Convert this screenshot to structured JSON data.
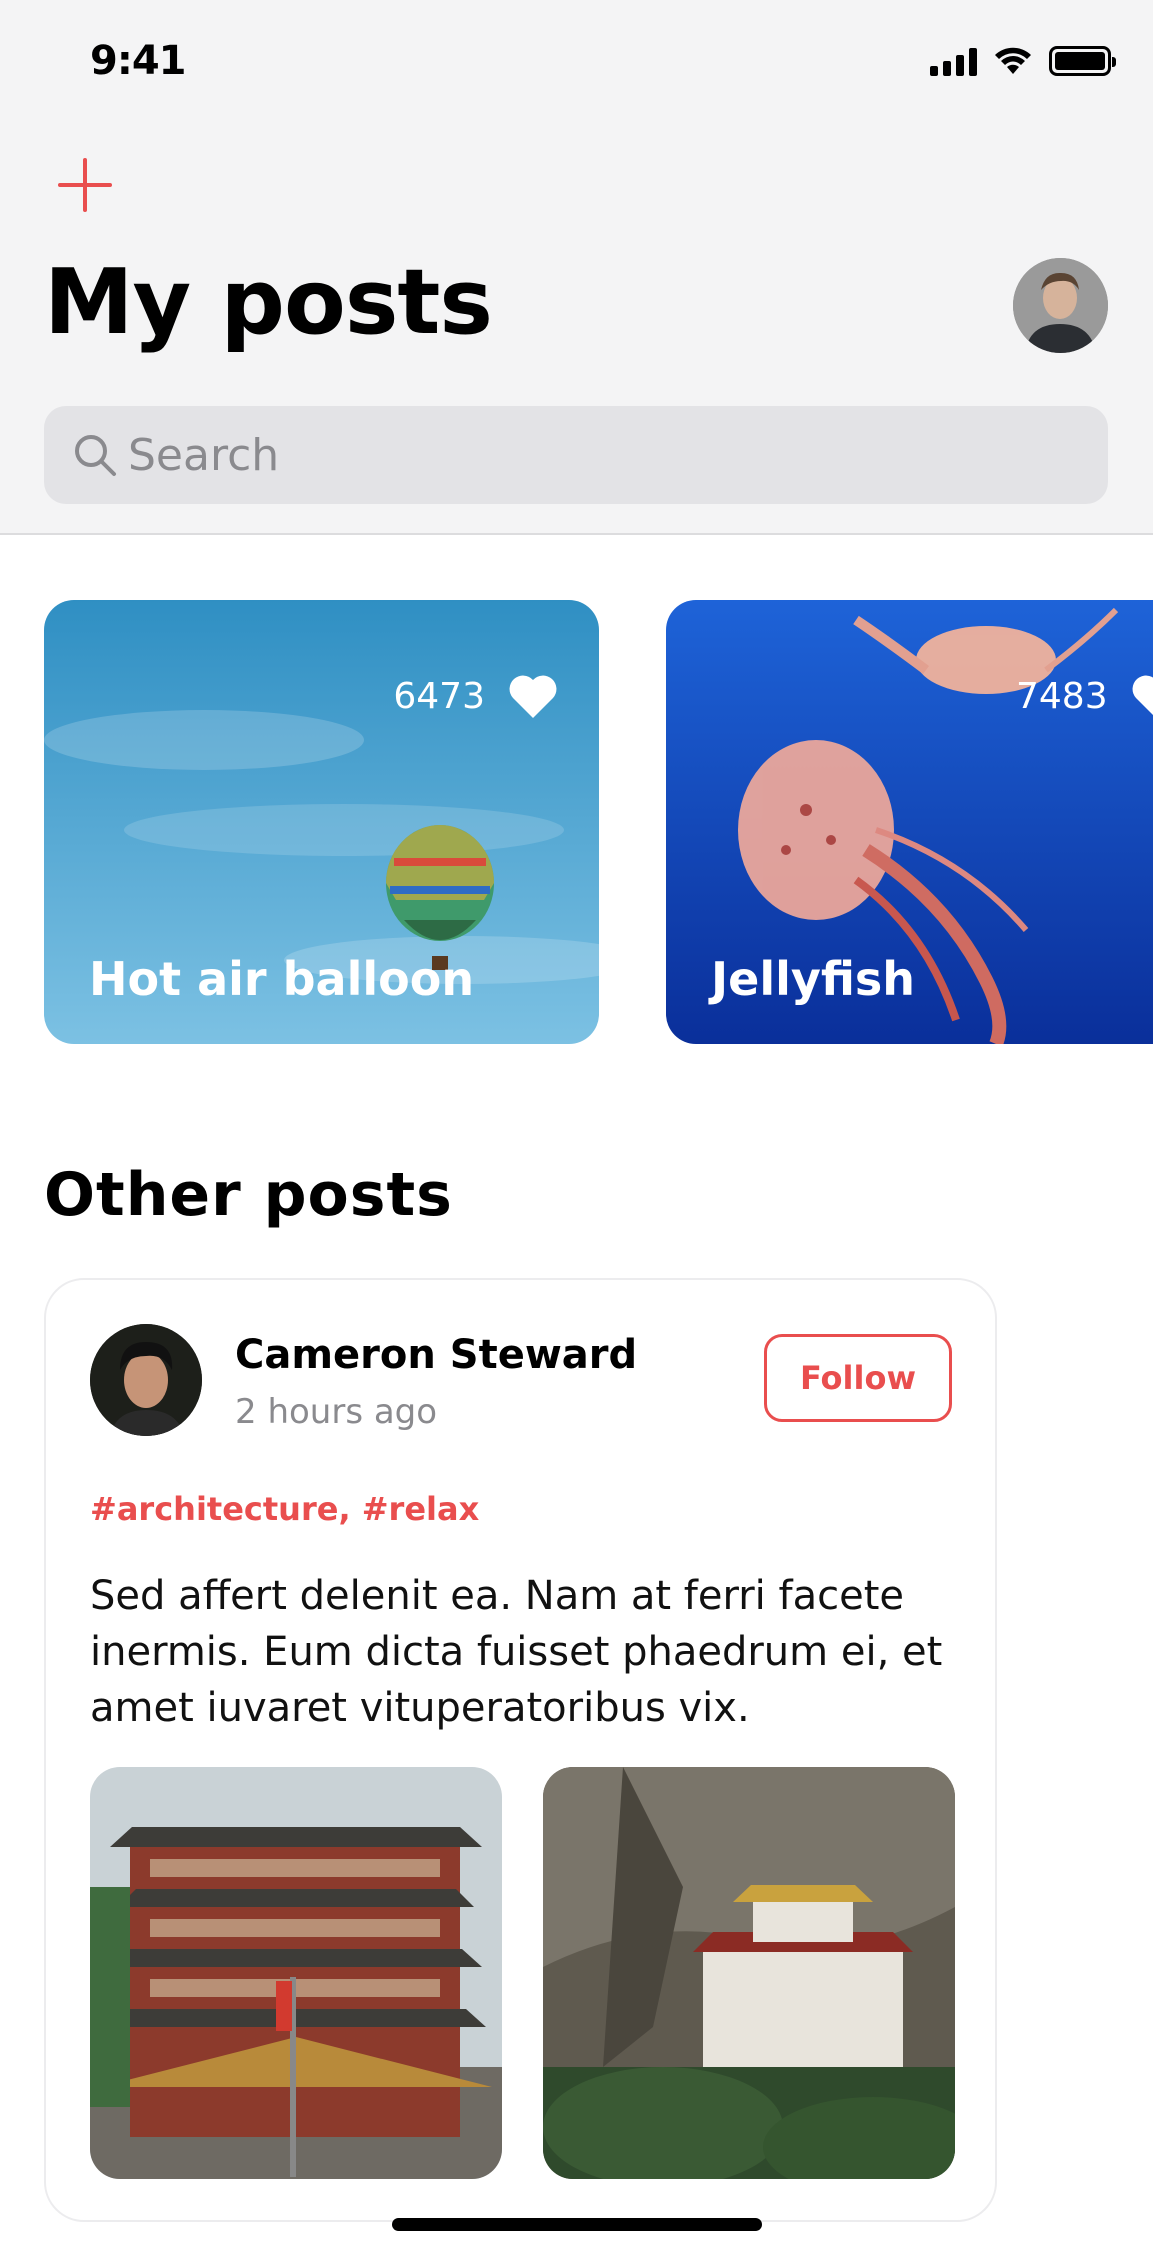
{
  "status_bar": {
    "time": "9:41"
  },
  "header": {
    "title": "My posts",
    "search_placeholder": "Search"
  },
  "my_posts": [
    {
      "title": "Hot air balloon",
      "likes": "6473"
    },
    {
      "title": "Jellyfish",
      "likes": "7483"
    }
  ],
  "other_posts": {
    "section_title": "Other posts",
    "post": {
      "author": "Cameron Steward",
      "time": "2 hours ago",
      "follow_label": "Follow",
      "tags": "#architecture, #relax",
      "body": "Sed affert delenit ea. Nam at ferri facete inermis. Eum dicta fuisset phaedrum ei, et amet iuvaret vituperatoribus vix."
    }
  },
  "colors": {
    "accent": "#e94e4e",
    "header_bg": "#f4f4f5",
    "search_bg": "#e3e3e6",
    "muted_text": "#8a8a8e"
  },
  "icons": [
    "plus-icon",
    "search-icon",
    "heart-icon",
    "signal-icon",
    "wifi-icon",
    "battery-icon"
  ]
}
